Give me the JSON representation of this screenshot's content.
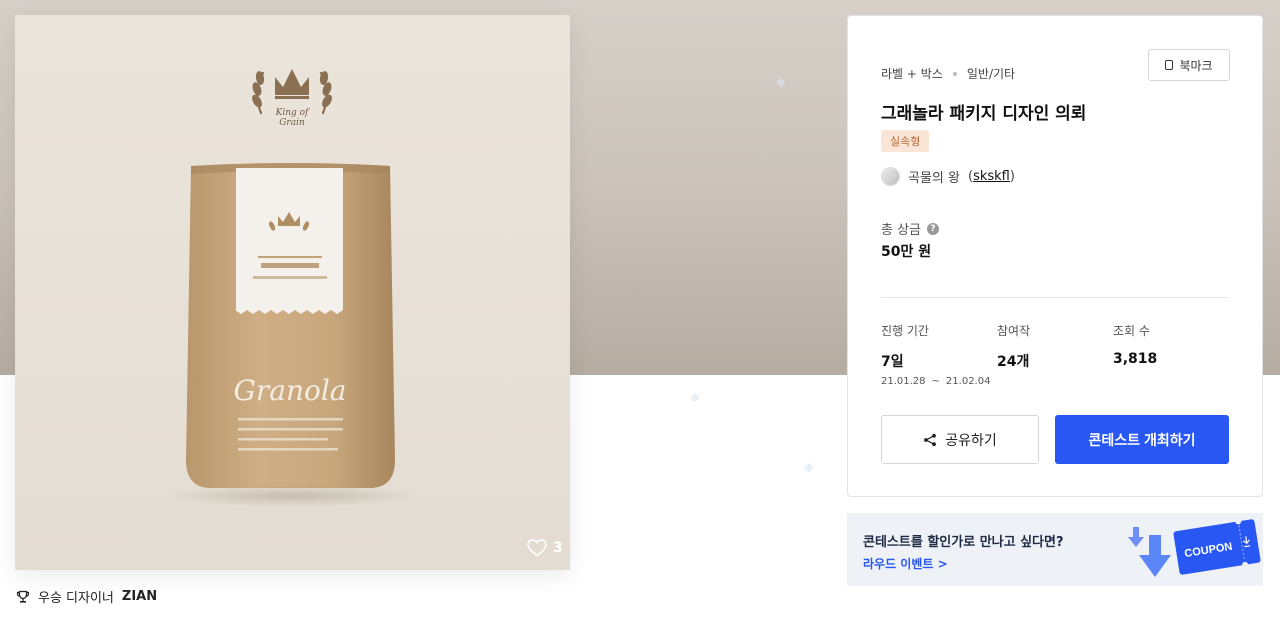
{
  "colors": {
    "accent": "#2857f3",
    "badge_bg": "#fbe5d6",
    "badge_text": "#b56a3a",
    "banner_bg": "#eef1f5"
  },
  "gallery": {
    "like_count": "3",
    "like_icon": "heart-outline-icon"
  },
  "winner": {
    "icon": "trophy-icon",
    "label": "우승 디자이너",
    "name": "ZIAN"
  },
  "contest": {
    "category_main": "라벨 + 박스",
    "category_sub": "일반/기타",
    "bookmark_label": "북마크",
    "title": "그래놀라 패키지 디자인 의뢰",
    "badge": "실속형",
    "author_name": "곡물의 왕",
    "author_id": "skskfl",
    "prize_label": "총 상금",
    "prize_value": "50만 원",
    "stats": {
      "period_label": "진행 기간",
      "period_value": "7일",
      "period_start": "21.01.28",
      "period_sep": "~",
      "period_end": "21.02.04",
      "entries_label": "참여작",
      "entries_value": "24개",
      "views_label": "조회 수",
      "views_value": "3,818"
    },
    "share_label": "공유하기",
    "host_label": "콘테스트 개최하기"
  },
  "banner": {
    "title": "콘테스트를 할인가로 만나고 싶다면?",
    "link": "라우드 이벤트 >",
    "coupon_text": "COUPON"
  }
}
